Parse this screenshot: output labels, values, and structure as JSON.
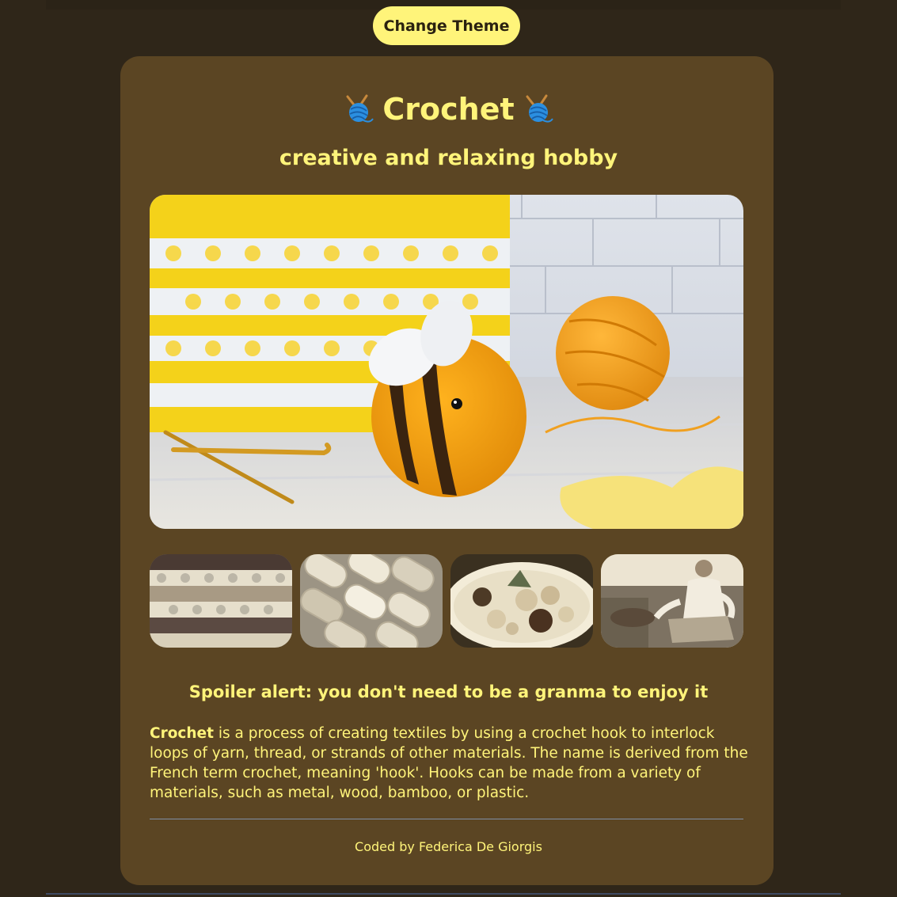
{
  "header": {
    "theme_button_label": "Change Theme"
  },
  "hero": {
    "title": "Crochet",
    "title_icon": "yarn-ball-knitting-needles-icon",
    "subtitle": "creative and relaxing hobby"
  },
  "gallery": {
    "main_image": "amigurumi-bee-photo",
    "thumbnails": [
      "crochet-stitch-pattern-photo",
      "yarn-skeins-photo",
      "crochet-pieces-bowl-photo",
      "person-crocheting-on-sofa-photo"
    ]
  },
  "content": {
    "heading": "Spoiler alert: you don't need to be a granma to enjoy it",
    "paragraph_bold": "Crochet",
    "paragraph_rest": " is a process of creating textiles by using a crochet hook to interlock loops of yarn, thread, or strands of other materials. The name is derived from the French term crochet, meaning 'hook'. Hooks can be made from a variety of materials, such as metal, wood, bamboo, or plastic."
  },
  "footer": {
    "credit": "Coded by Federica De Giorgis"
  },
  "colors": {
    "page_background": "#2f2619",
    "card_background": "#5b4523",
    "accent_yellow": "#fff47a",
    "divider": "#7f8fa6"
  }
}
